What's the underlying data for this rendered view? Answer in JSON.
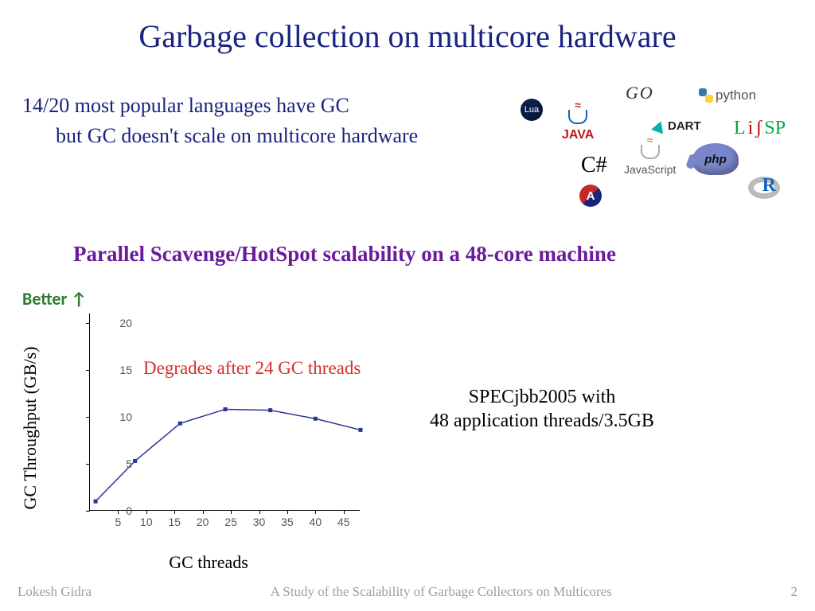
{
  "title": "Garbage collection on multicore hardware",
  "bullets": {
    "main": "14/20 most popular languages have GC",
    "sub": "but GC doesn't scale on multicore hardware"
  },
  "subtitle": "Parallel Scavenge/HotSpot scalability on a 48-core machine",
  "better_label": "Better ↑",
  "annotation": "Degrades after 24 GC threads",
  "caption_line1": "SPECjbb2005 with",
  "caption_line2": "48 application threads/3.5GB",
  "footer": {
    "author": "Lokesh Gidra",
    "paper": "A Study of the Scalability of Garbage Collectors on Multicores",
    "page": "2"
  },
  "logos": {
    "lua": "Lua",
    "java": "JAVA",
    "go": "GO",
    "python": "python",
    "dart": "DART",
    "lisp_l": "L",
    "lisp_i": "i",
    "lisp_sp": "SP",
    "lisp_s": "ʃ",
    "csharp": "C#",
    "js": "JavaScript",
    "php": "php",
    "a": "A",
    "r": "R"
  },
  "chart_data": {
    "type": "line",
    "title": "Parallel Scavenge/HotSpot scalability on a 48-core machine",
    "xlabel": "GC threads",
    "ylabel": "GC Throughput (GB/s)",
    "xlim": [
      0,
      48
    ],
    "ylim": [
      0,
      21
    ],
    "xticks": [
      5,
      10,
      15,
      20,
      25,
      30,
      35,
      40,
      45
    ],
    "yticks": [
      0,
      5,
      10,
      15,
      20
    ],
    "x": [
      1,
      8,
      16,
      24,
      32,
      40,
      48
    ],
    "values": [
      1.0,
      5.3,
      9.3,
      10.8,
      10.7,
      9.8,
      8.6
    ],
    "annotation": "Degrades after 24 GC threads"
  }
}
